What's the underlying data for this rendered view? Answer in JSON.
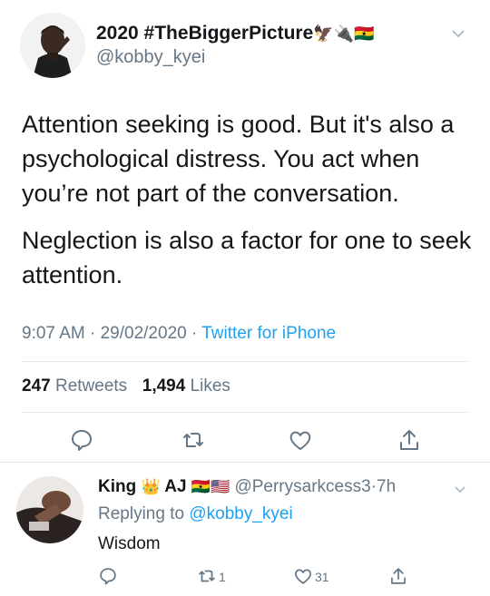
{
  "tweet": {
    "display_name": "2020 #TheBiggerPicture",
    "name_emojis": "🦅🔌🇬🇭",
    "handle": "@kobby_kyei",
    "text_para1": "Attention seeking is good. But it's also a psychological distress. You act when you’re  not part of the conversation.",
    "text_para2": "Neglection is also a factor for one to seek attention.",
    "time": "9:07 AM",
    "date": "29/02/2020",
    "source": "Twitter for iPhone",
    "retweets_count": "247",
    "retweets_label": "Retweets",
    "likes_count": "1,494",
    "likes_label": "Likes"
  },
  "reply": {
    "name_part1": "King",
    "name_emoji1": "👑",
    "name_part2": "AJ",
    "name_emoji2": "🇬🇭🇺🇸",
    "handle": "@Perrysarkcess3",
    "time": "7h",
    "replying_prefix": "Replying to",
    "replying_to": "@kobby_kyei",
    "text": "Wisdom",
    "retweet_count": "1",
    "like_count": "31"
  },
  "colors": {
    "accent": "#1da1f2",
    "secondary_text": "#657786",
    "divider": "#e1e8ed"
  },
  "icons": {
    "reply": "reply-icon",
    "retweet": "retweet-icon",
    "like": "heart-icon",
    "share": "share-icon",
    "caret": "chevron-down-icon"
  }
}
